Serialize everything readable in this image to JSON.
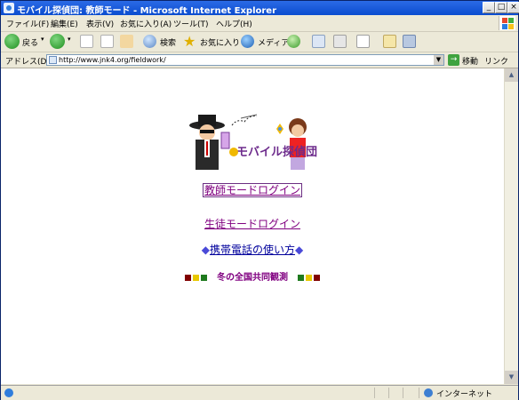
{
  "window": {
    "title": "モバイル探偵団: 教師モード - Microsoft Internet Explorer",
    "minimize": "_",
    "maximize": "□",
    "close": "×"
  },
  "menu": [
    "ファイル(F)",
    "編集(E)",
    "表示(V)",
    "お気に入り(A)",
    "ツール(T)",
    "ヘルプ(H)"
  ],
  "toolbar": {
    "back_label": "戻る",
    "search_label": "検索",
    "favorites_label": "お気に入り",
    "media_label": "メディア"
  },
  "address": {
    "label": "アドレス(D)",
    "url": "http://www.jnk4.org/fieldwork/",
    "go_label": "移動",
    "links_label": "リンク"
  },
  "page": {
    "logo_text": "モバイル探偵団",
    "teacher_login": "教師モードログイン",
    "student_login": "生徒モードログイン",
    "phone_marker_left": "◆",
    "phone_link": "携帯電話の使い方",
    "phone_marker_right": "◆",
    "event_link": "冬の全国共同観測"
  },
  "status": {
    "zone": "インターネット"
  },
  "colors": {
    "titlebar": "#0a4ccf",
    "link_visited": "#800080",
    "link": "#00009c",
    "square_red": "#800000",
    "square_yellow": "#e8c800",
    "square_green": "#1e7a1e"
  }
}
